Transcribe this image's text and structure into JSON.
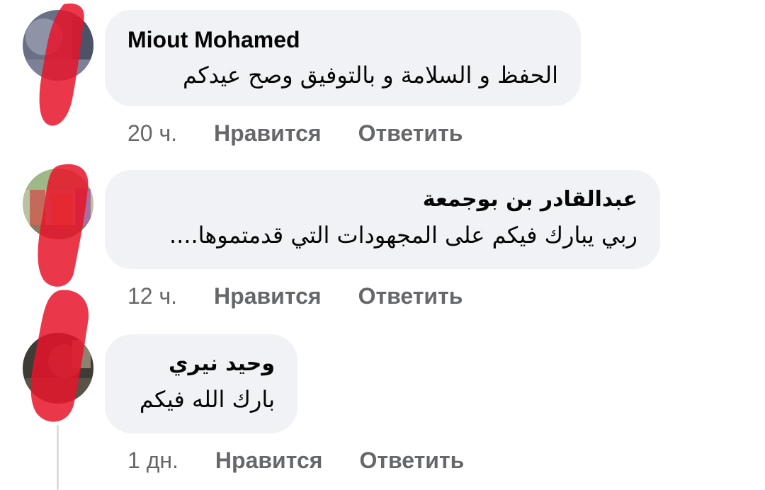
{
  "comments": [
    {
      "author": "Miout Mohamed",
      "text": "الحفظ و السلامة و بالتوفيق وصح عيدكم",
      "time": "20 ч.",
      "like_label": "Нравится",
      "reply_label": "Ответить"
    },
    {
      "author": "عبدالقادر بن بوجمعة",
      "text": "ربي يبارك فيكم على المجهودات التي قدمتموها....",
      "time": "12 ч.",
      "like_label": "Нравится",
      "reply_label": "Ответить"
    },
    {
      "author": "وحيد نيري",
      "text": "بارك الله فيكم",
      "time": "1 дн.",
      "like_label": "Нравится",
      "reply_label": "Ответить"
    }
  ],
  "colors": {
    "bubble_bg": "#f0f2f5",
    "text": "#050505",
    "secondary_text": "#65676b",
    "redaction": "#e8142a"
  }
}
